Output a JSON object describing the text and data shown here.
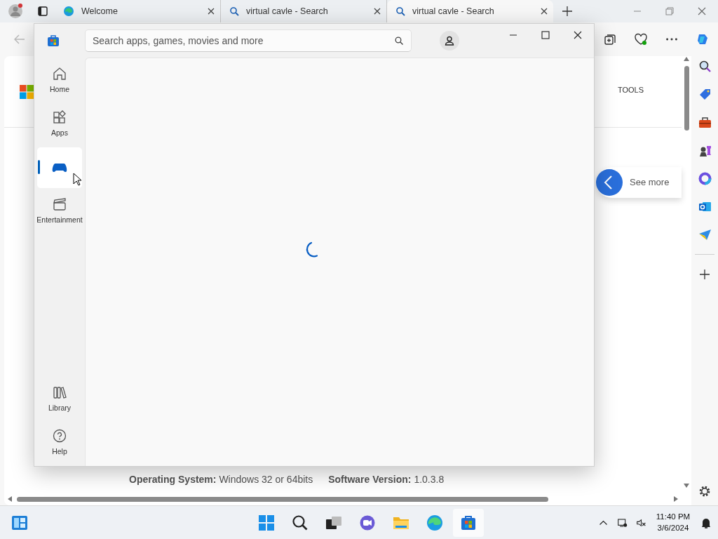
{
  "browser": {
    "tabs": [
      {
        "title": "Welcome",
        "kind": "edge",
        "selected": false
      },
      {
        "title": "virtual cavle - Search",
        "kind": "search",
        "selected": false
      },
      {
        "title": "virtual cavle - Search",
        "kind": "search",
        "selected": true
      }
    ]
  },
  "page": {
    "tools_label": "TOOLS",
    "see_more": "See more",
    "specs": [
      {
        "label": "Operating System:",
        "value": "Windows 32 or 64bits"
      },
      {
        "label": "Software Version:",
        "value": "1.0.3.8"
      }
    ]
  },
  "store": {
    "search_placeholder": "Search apps, games, movies and more",
    "nav": [
      {
        "label": "Home",
        "kind": "home",
        "selected": false
      },
      {
        "label": "Apps",
        "kind": "apps",
        "selected": false
      },
      {
        "kind": "gaming",
        "selected": true
      },
      {
        "label": "Entertainment",
        "kind": "movie",
        "selected": false
      }
    ],
    "nav_bottom": [
      {
        "label": "Library",
        "kind": "library",
        "selected": false
      },
      {
        "label": "Help",
        "kind": "help",
        "selected": false
      }
    ]
  },
  "taskbar": {
    "time": "11:40 PM",
    "date": "3/6/2024"
  }
}
